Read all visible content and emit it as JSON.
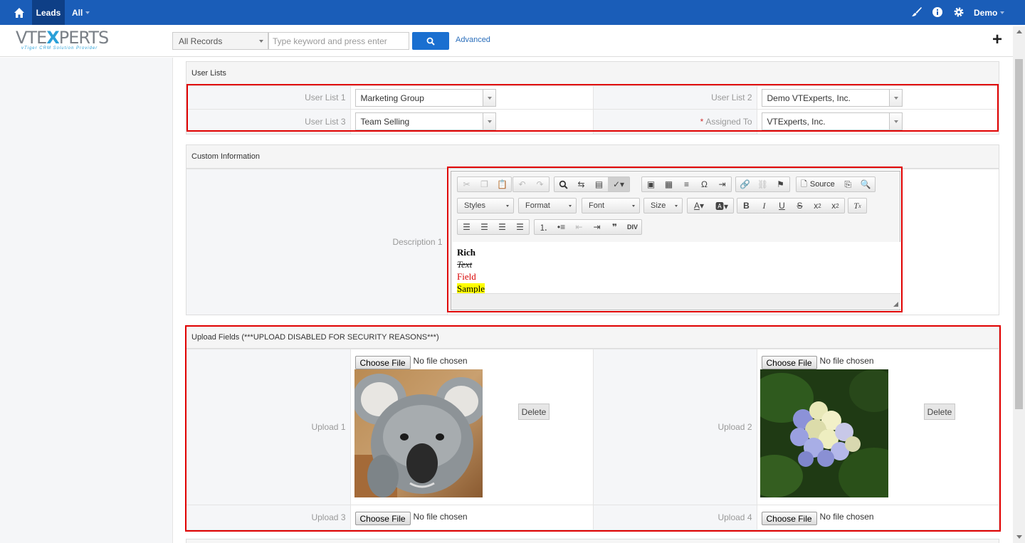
{
  "topnav": {
    "module": "Leads",
    "all_label": "All",
    "user": "Demo"
  },
  "header": {
    "logo_text_a": "VTE",
    "logo_text_x": "X",
    "logo_text_b": "PERTS",
    "logo_tagline": "vTiger CRM Solution Provider",
    "records_select": "All Records",
    "search_placeholder": "Type keyword and press enter",
    "advanced_link": "Advanced"
  },
  "user_lists": {
    "title": "User Lists",
    "fields": [
      {
        "label": "User List 1",
        "value": "Marketing Group"
      },
      {
        "label": "User List 2",
        "value": "Demo VTExperts, Inc."
      },
      {
        "label": "User List 3",
        "value": "Team Selling"
      },
      {
        "label": "Assigned To",
        "value": "VTExperts, Inc.",
        "required": "*"
      }
    ]
  },
  "custom_info": {
    "title": "Custom Information",
    "description_label": "Description 1",
    "editor": {
      "source_label": "Source",
      "styles_label": "Styles",
      "format_label": "Format",
      "font_label": "Font",
      "size_label": "Size",
      "content": [
        "Rich",
        "Text ",
        "Field",
        "Sample"
      ]
    }
  },
  "upload": {
    "title": "Upload Fields (***UPLOAD DISABLED FOR SECURITY REASONS***)",
    "choose_file": "Choose File",
    "no_file": "No file chosen",
    "delete_label": "Delete",
    "fields": [
      "Upload 1",
      "Upload 2",
      "Upload 3",
      "Upload 4"
    ]
  },
  "colors": {
    "nav_blue": "#1a5db8",
    "highlight_red": "#e00000"
  }
}
